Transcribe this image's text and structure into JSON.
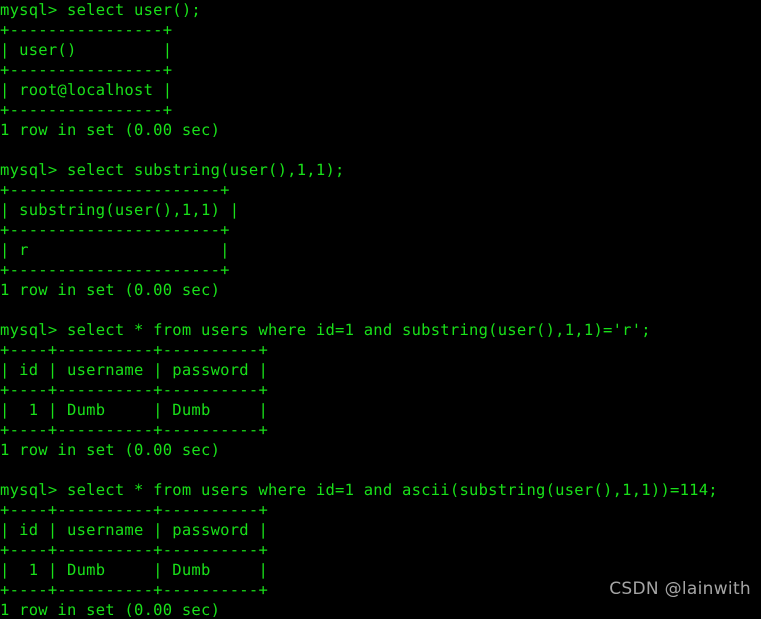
{
  "terminal": {
    "prompt": "mysql> ",
    "foreground_color": "#19e019",
    "background_color": "#000000",
    "lines": [
      "mysql> select user();",
      "+----------------+",
      "| user()         |",
      "+----------------+",
      "| root@localhost |",
      "+----------------+",
      "1 row in set (0.00 sec)",
      "",
      "mysql> select substring(user(),1,1);",
      "+----------------------+",
      "| substring(user(),1,1) |",
      "+----------------------+",
      "| r                    |",
      "+----------------------+",
      "1 row in set (0.00 sec)",
      "",
      "mysql> select * from users where id=1 and substring(user(),1,1)='r';",
      "+----+----------+----------+",
      "| id | username | password |",
      "+----+----------+----------+",
      "|  1 | Dumb     | Dumb     |",
      "+----+----------+----------+",
      "1 row in set (0.00 sec)",
      "",
      "mysql> select * from users where id=1 and ascii(substring(user(),1,1))=114;",
      "+----+----------+----------+",
      "| id | username | password |",
      "+----+----------+----------+",
      "|  1 | Dumb     | Dumb     |",
      "+----+----------+----------+",
      "1 row in set (0.00 sec)"
    ],
    "blocks": [
      {
        "command": "select user();",
        "result_columns": [
          "user()"
        ],
        "result_rows": [
          [
            "root@localhost"
          ]
        ],
        "status": "1 row in set (0.00 sec)"
      },
      {
        "command": "select substring(user(),1,1);",
        "result_columns": [
          "substring(user(),1,1)"
        ],
        "result_rows": [
          [
            "r"
          ]
        ],
        "status": "1 row in set (0.00 sec)"
      },
      {
        "command": "select * from users where id=1 and substring(user(),1,1)='r';",
        "result_columns": [
          "id",
          "username",
          "password"
        ],
        "result_rows": [
          [
            "1",
            "Dumb",
            "Dumb"
          ]
        ],
        "status": "1 row in set (0.00 sec)"
      },
      {
        "command": "select * from users where id=1 and ascii(substring(user(),1,1))=114;",
        "result_columns": [
          "id",
          "username",
          "password"
        ],
        "result_rows": [
          [
            "1",
            "Dumb",
            "Dumb"
          ]
        ],
        "status": "1 row in set (0.00 sec)"
      }
    ]
  },
  "watermark": {
    "text": "CSDN @lainwith",
    "color": "#c9c9c9"
  }
}
